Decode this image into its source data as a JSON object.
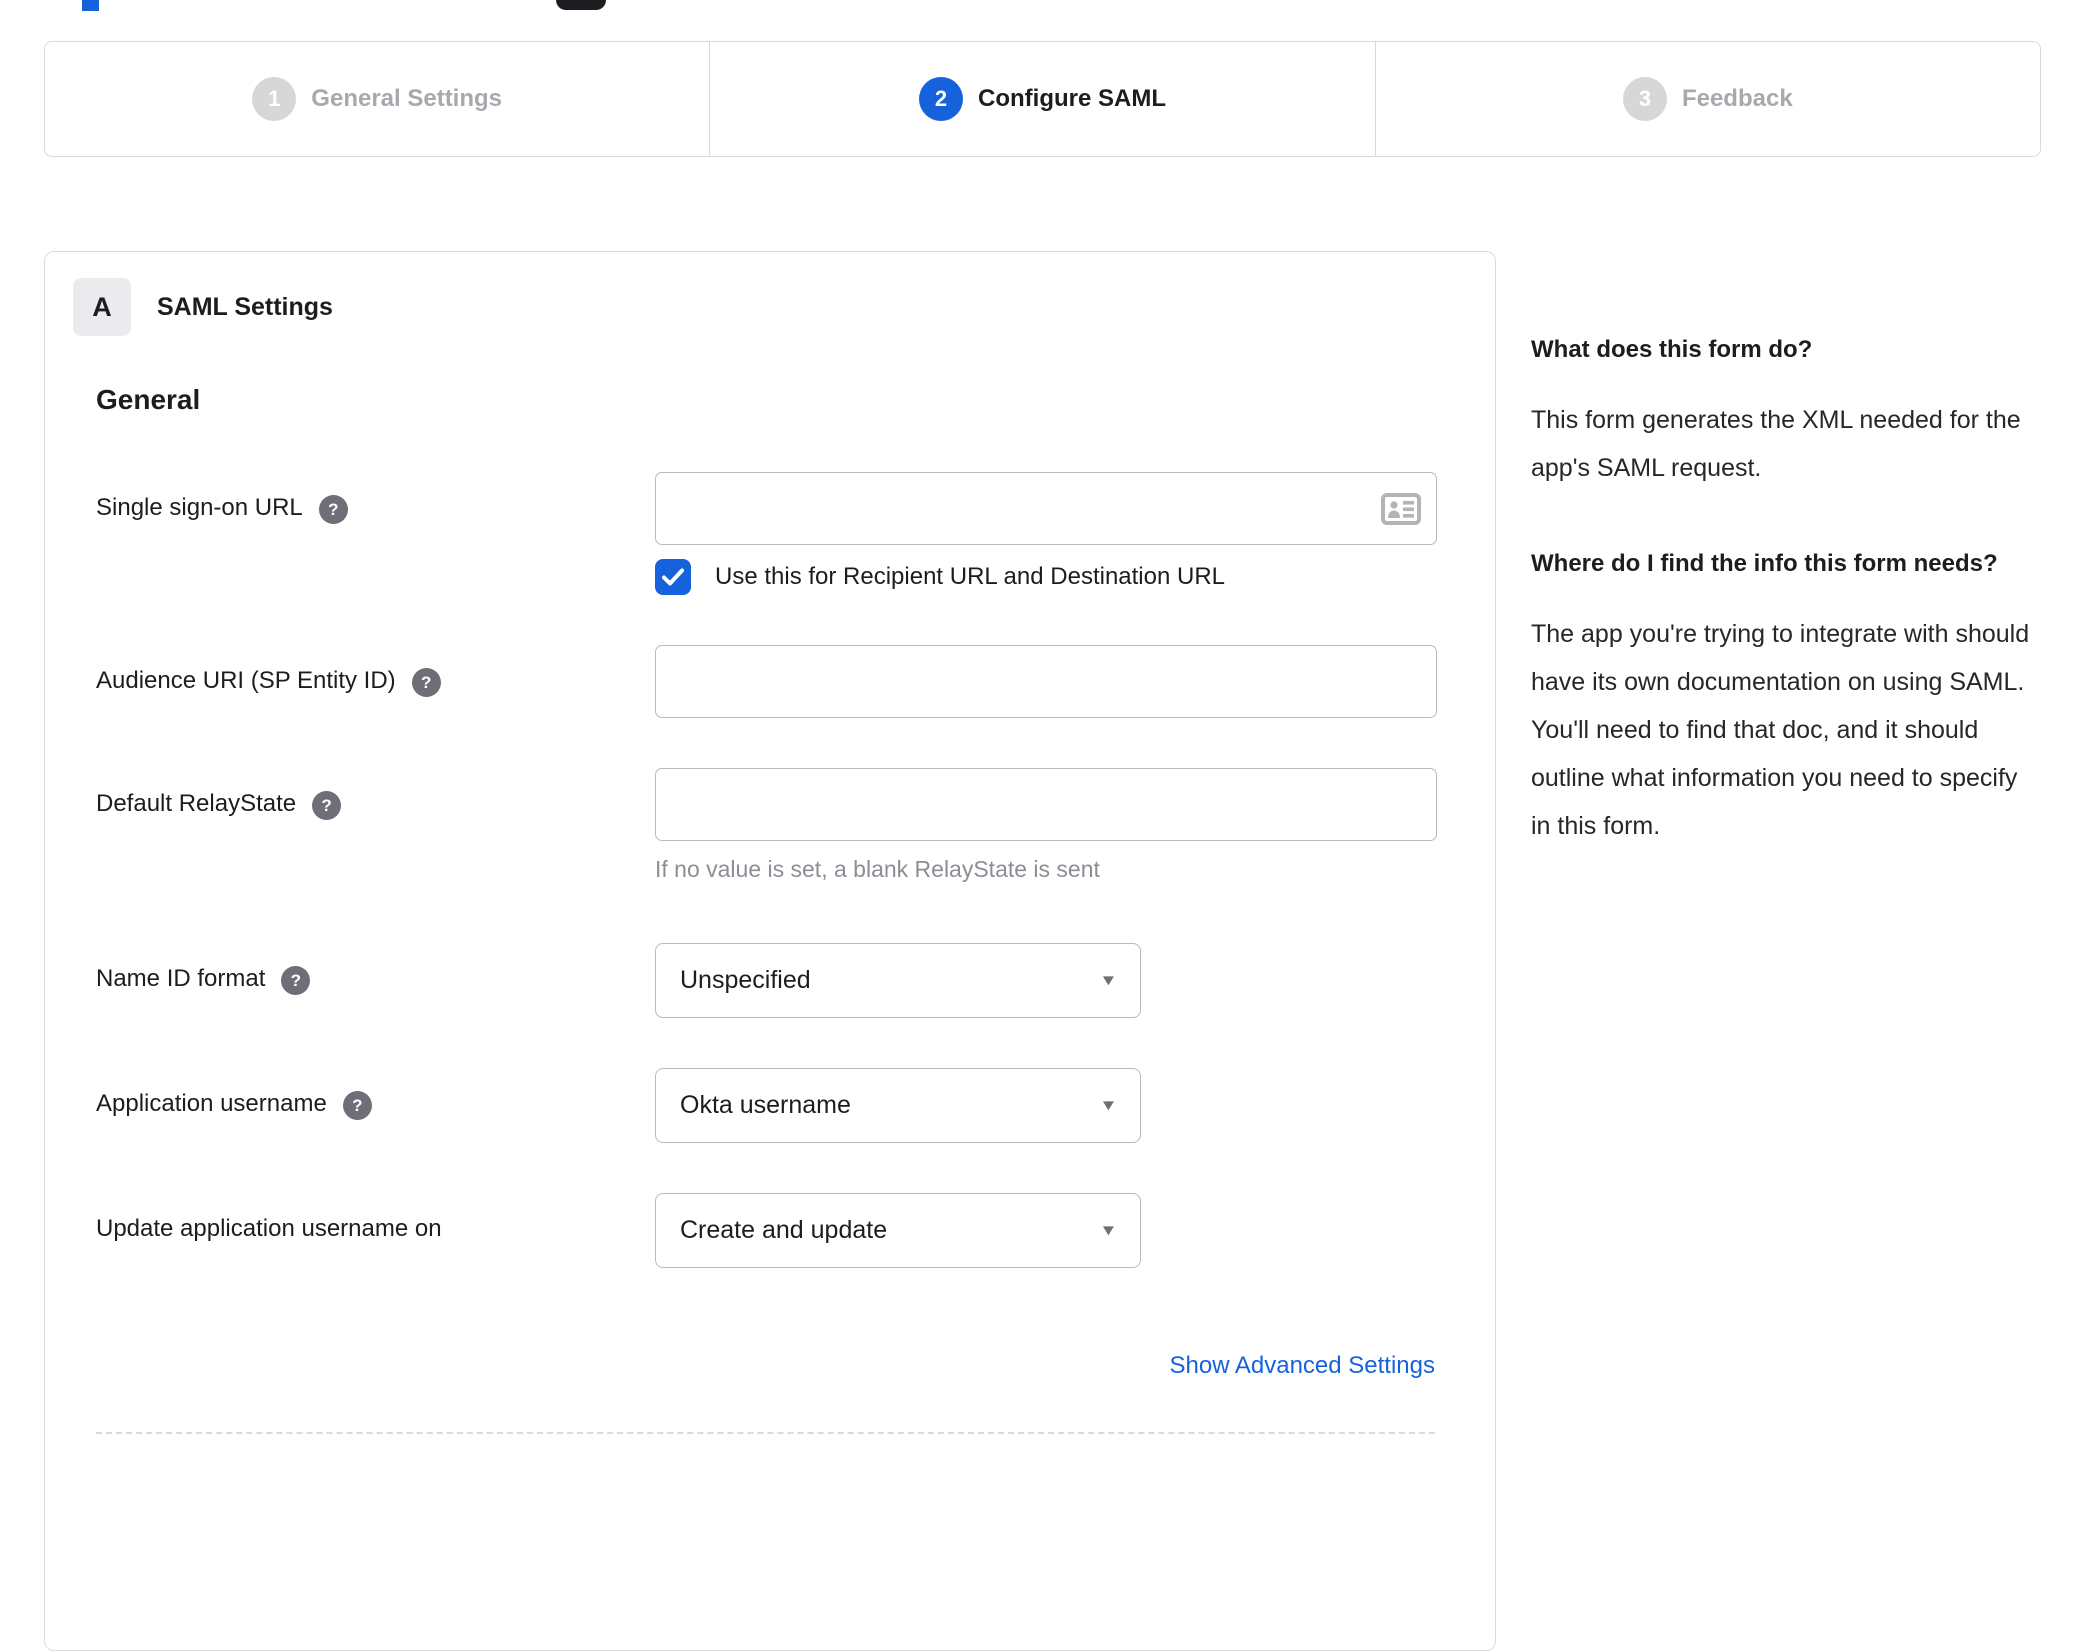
{
  "colors": {
    "accent_blue": "#1662dd",
    "inactive_step_gray": "#d7d7d9",
    "text_dark": "#1d1d21",
    "helper_gray": "#8d8d96"
  },
  "icons": {
    "help_glyph": "?",
    "dropdown_arrow": "▼"
  },
  "stepper": {
    "steps": [
      {
        "number": "1",
        "label": "General Settings",
        "state": "inactive"
      },
      {
        "number": "2",
        "label": "Configure SAML",
        "state": "active"
      },
      {
        "number": "3",
        "label": "Feedback",
        "state": "inactive"
      }
    ]
  },
  "saml_panel": {
    "section_badge": "A",
    "section_title": "SAML Settings",
    "group_title": "General",
    "fields": [
      {
        "label": "Single sign-on URL",
        "value": "",
        "checkbox_label": "Use this for Recipient URL and Destination URL",
        "checked": true
      },
      {
        "label": "Audience URI (SP Entity ID)",
        "value": ""
      },
      {
        "label": "Default RelayState",
        "value": "",
        "helper": "If no value is set, a blank RelayState is sent"
      },
      {
        "label": "Name ID format",
        "value": "Unspecified"
      },
      {
        "label": "Application username",
        "value": "Okta username"
      },
      {
        "label": "Update application username on",
        "value": "Create and update"
      }
    ],
    "advanced_link": "Show Advanced Settings"
  },
  "help_panel": {
    "sections": [
      {
        "heading": "What does this form do?",
        "body": "This form generates the XML needed for the app's SAML request."
      },
      {
        "heading": "Where do I find the info this form needs?",
        "body": "The app you're trying to integrate with should have its own documentation on using SAML. You'll need to find that doc, and it should outline what information you need to specify in this form."
      }
    ]
  }
}
